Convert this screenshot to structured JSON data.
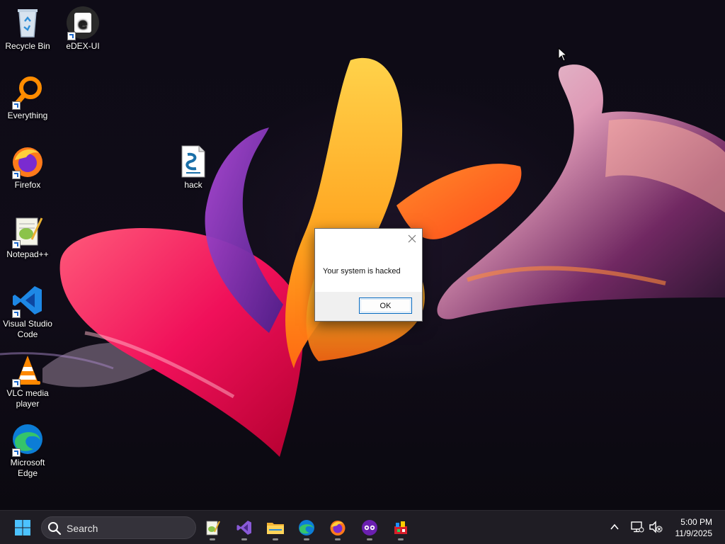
{
  "desktop": {
    "icons": [
      {
        "label": "Recycle Bin",
        "icon": "recycle-bin-icon"
      },
      {
        "label": "eDEX-UI",
        "icon": "edex-ui-icon"
      },
      {
        "label": "Everything",
        "icon": "everything-search-icon"
      },
      {
        "label": "Firefox",
        "icon": "firefox-icon"
      },
      {
        "label": "Notepad++",
        "icon": "notepad-plus-plus-icon"
      },
      {
        "label": "Visual Studio Code",
        "icon": "vscode-icon"
      },
      {
        "label": "VLC media player",
        "icon": "vlc-icon"
      },
      {
        "label": "Microsoft Edge",
        "icon": "edge-icon"
      },
      {
        "label": "hack",
        "icon": "script-file-icon"
      }
    ]
  },
  "dialog": {
    "message": "Your system is hacked",
    "ok_label": "OK",
    "close_icon": "close-icon"
  },
  "taskbar": {
    "search_label": "Search",
    "apps": [
      "notepad-plus-plus",
      "visual-studio",
      "file-explorer",
      "edge",
      "firefox",
      "app-purple",
      "app-colorful"
    ],
    "time": "5:00 PM",
    "date": "11/9/2025"
  },
  "colors": {
    "accent": "#0067c0",
    "taskbar": "#1f1d24"
  }
}
